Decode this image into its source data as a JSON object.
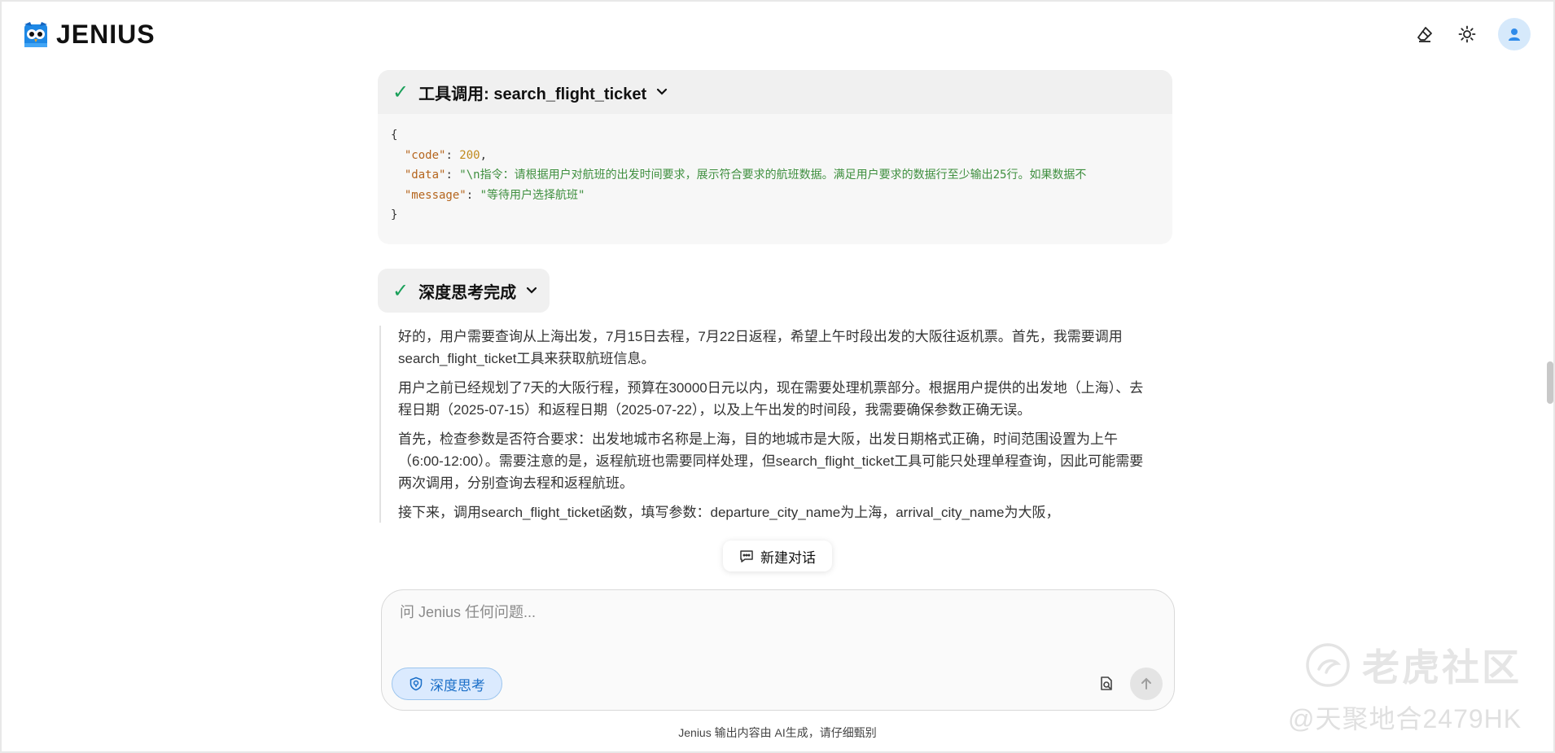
{
  "app": {
    "brand": "JENIUS",
    "colors": {
      "accent": "#1b6fc8",
      "success": "#1aa05a",
      "logo_blue": "#1e88e5"
    }
  },
  "header": {
    "icons": [
      "eraser-icon",
      "sun-icon",
      "user-avatar-icon"
    ]
  },
  "tool_call": {
    "title": "工具调用: search_flight_ticket",
    "code": {
      "open": "{",
      "close": "}",
      "lines": [
        {
          "key": "\"code\"",
          "sep": ": ",
          "value": "200",
          "tail": ","
        },
        {
          "key": "\"data\"",
          "sep": ": ",
          "value": "\"\\n指令：请根据用户对航班的出发时间要求，展示符合要求的航班数据。满足用户要求的数据行至少输出25行。如果数据不",
          "tail": ""
        },
        {
          "key": "\"message\"",
          "sep": ": ",
          "value": "\"等待用户选择航班\"",
          "tail": ""
        }
      ]
    }
  },
  "thinking": {
    "title": "深度思考完成",
    "paragraphs": [
      "好的，用户需要查询从上海出发，7月15日去程，7月22日返程，希望上午时段出发的大阪往返机票。首先，我需要调用search_flight_ticket工具来获取航班信息。",
      "用户之前已经规划了7天的大阪行程，预算在30000日元以内，现在需要处理机票部分。根据用户提供的出发地（上海）、去程日期（2025-07-15）和返程日期（2025-07-22），以及上午出发的时间段，我需要确保参数正确无误。",
      "首先，检查参数是否符合要求：出发地城市名称是上海，目的地城市是大阪，出发日期格式正确，时间范围设置为上午（6:00-12:00）。需要注意的是，返程航班也需要同样处理，但search_flight_ticket工具可能只处理单程查询，因此可能需要两次调用，分别查询去程和返程航班。",
      "接下来，调用search_flight_ticket函数，填写参数：departure_city_name为上海，arrival_city_name为大阪，"
    ]
  },
  "new_chat": {
    "label": "新建对话"
  },
  "composer": {
    "placeholder": "问 Jenius 任何问题...",
    "value": "",
    "deep_think_label": "深度思考"
  },
  "footer": {
    "text": "Jenius 输出内容由 AI生成，请仔细甄别"
  },
  "watermark": {
    "line1": "老虎社区",
    "line2": "@天聚地合2479HK"
  }
}
